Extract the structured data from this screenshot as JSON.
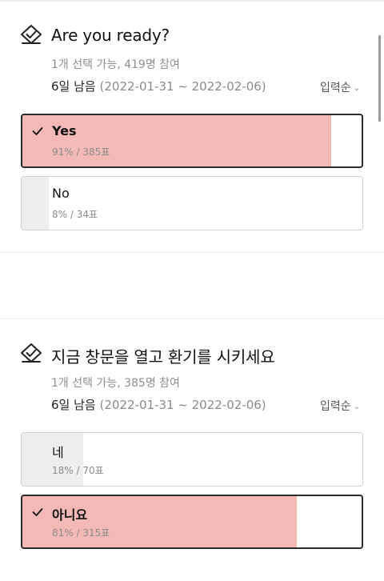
{
  "polls": [
    {
      "title": "Are you ready?",
      "meta": "1개 선택 가능, 419명 참여",
      "deadline_remaining": "6일 남음",
      "deadline_range": "(2022-01-31 ~ 2022-02-06)",
      "sort_label": "입력순",
      "options": [
        {
          "label": "Yes",
          "stats": "91% / 385표",
          "percent": 91,
          "selected": true
        },
        {
          "label": "No",
          "stats": "8% / 34표",
          "percent": 8,
          "selected": false
        }
      ]
    },
    {
      "title": "지금 창문을 열고 환기를 시키세요",
      "meta": "1개 선택 가능, 385명 참여",
      "deadline_remaining": "6일 남음",
      "deadline_range": "(2022-01-31 ~ 2022-02-06)",
      "sort_label": "입력순",
      "options": [
        {
          "label": "네",
          "stats": "18% / 70표",
          "percent": 18,
          "selected": false
        },
        {
          "label": "아니요",
          "stats": "81% / 315표",
          "percent": 81,
          "selected": true
        }
      ]
    }
  ],
  "icons": {
    "vote": "vote-check-icon",
    "check": "checkmark-icon",
    "sort": "chevron-down-icon"
  },
  "colors": {
    "selected_fill": "#f3b9b7",
    "unselected_fill": "#eeeeee",
    "selected_border": "#2a2a2a",
    "option_border": "#d2d2d2"
  }
}
